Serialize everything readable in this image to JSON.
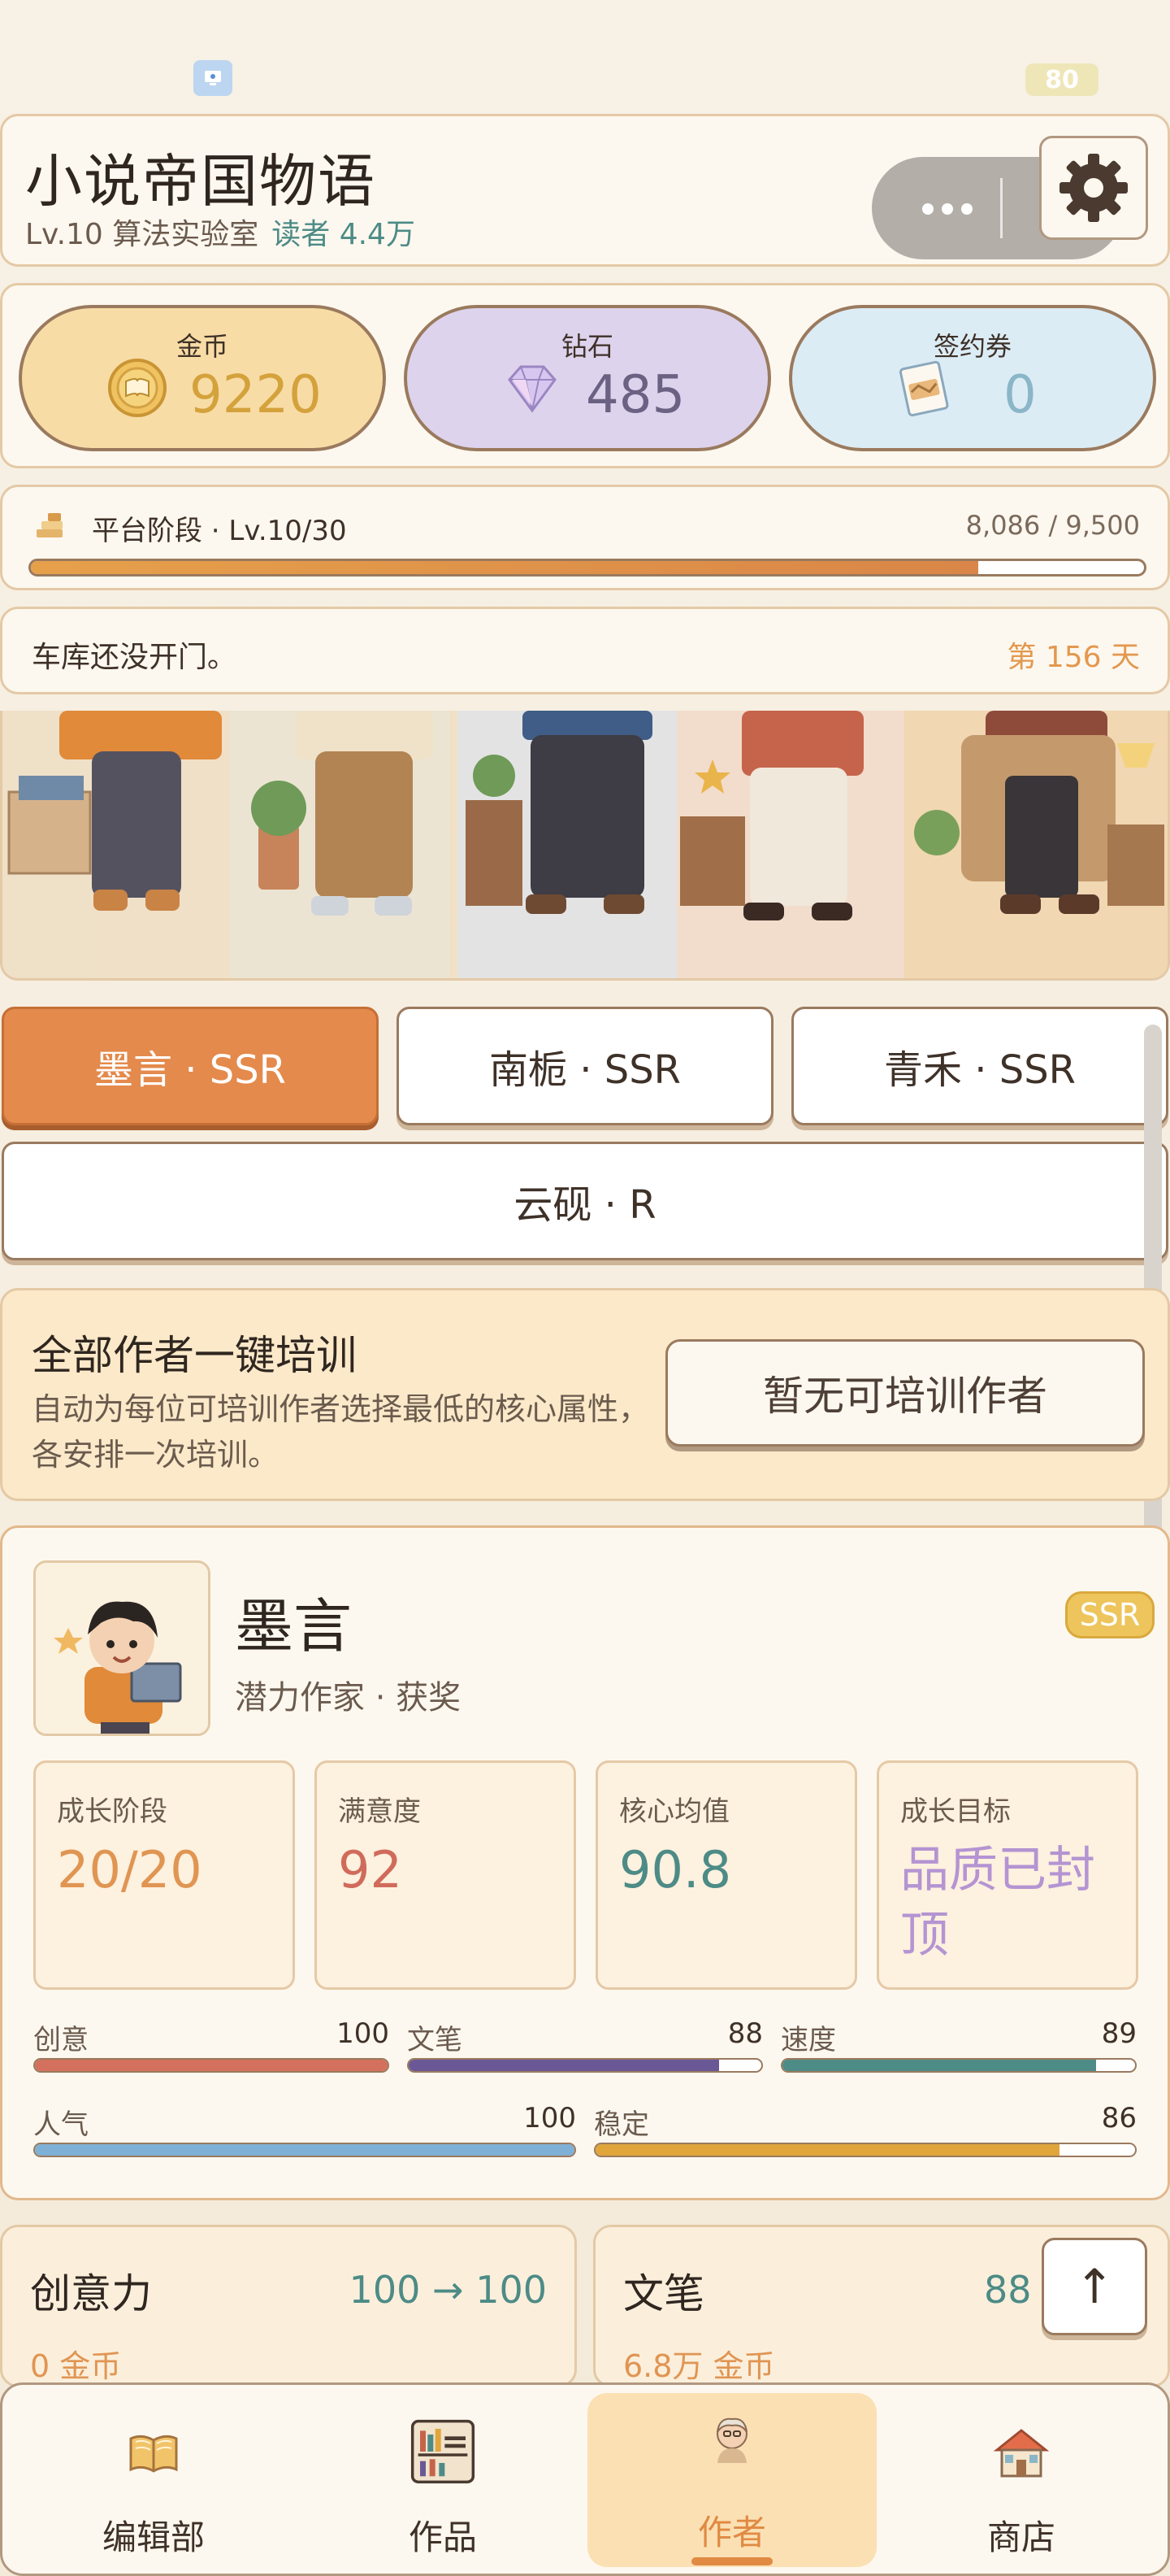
{
  "status": {
    "battery": "80"
  },
  "header": {
    "title": "小说帝国物语",
    "level": "Lv.10 算法实验室",
    "readers": "读者 4.4万"
  },
  "currency": {
    "gold": {
      "label": "金币",
      "value": "9220",
      "icon": "coin-icon"
    },
    "diamond": {
      "label": "钻石",
      "value": "485",
      "icon": "diamond-icon"
    },
    "ticket": {
      "label": "签约券",
      "value": "0",
      "icon": "ticket-icon"
    }
  },
  "stage": {
    "label": "平台阶段 · Lv.10/30",
    "count": "8,086 / 9,500",
    "progress": 0.851
  },
  "notice": {
    "text": "车库还没开门。",
    "day": "第 156 天"
  },
  "authorTabs": [
    "墨言 · SSR",
    "南栀 · SSR",
    "青禾 · SSR",
    "云砚 · R"
  ],
  "training": {
    "title": "全部作者一键培训",
    "desc": "自动为每位可培训作者选择最低的核心属性，各安排一次培训。",
    "button": "暂无可培训作者"
  },
  "author": {
    "name": "墨言",
    "tags": "潜力作家 · 获奖",
    "rarity": "SSR",
    "stats": [
      {
        "label": "成长阶段",
        "value": "20/20"
      },
      {
        "label": "满意度",
        "value": "92"
      },
      {
        "label": "核心均值",
        "value": "90.8"
      },
      {
        "label": "成长目标",
        "value": "品质已封顶"
      }
    ],
    "attributes": [
      {
        "name": "创意",
        "value": "100",
        "ratio": 1.0,
        "color": "#d4705e"
      },
      {
        "name": "文笔",
        "value": "88",
        "ratio": 0.88,
        "color": "#6a5896"
      },
      {
        "name": "速度",
        "value": "89",
        "ratio": 0.89,
        "color": "#4d8b86"
      },
      {
        "name": "人气",
        "value": "100",
        "ratio": 1.0,
        "color": "#7fb0d6"
      },
      {
        "name": "稳定",
        "value": "86",
        "ratio": 0.86,
        "color": "#e0a63c"
      }
    ]
  },
  "skills": [
    {
      "name": "创意力",
      "value": "100 → 100",
      "cost": "0 金币"
    },
    {
      "name": "文笔",
      "value": "88",
      "cost": "6.8万 金币"
    }
  ],
  "scrollTop": "↑",
  "nav": [
    {
      "label": "编辑部",
      "icon": "book-icon"
    },
    {
      "label": "作品",
      "icon": "bookshelf-icon"
    },
    {
      "label": "作者",
      "icon": "author-icon"
    },
    {
      "label": "商店",
      "icon": "shop-icon"
    }
  ],
  "colors": {
    "accent": "#e48a4c",
    "background": "#f6efe2",
    "teal": "#4d8b86"
  }
}
